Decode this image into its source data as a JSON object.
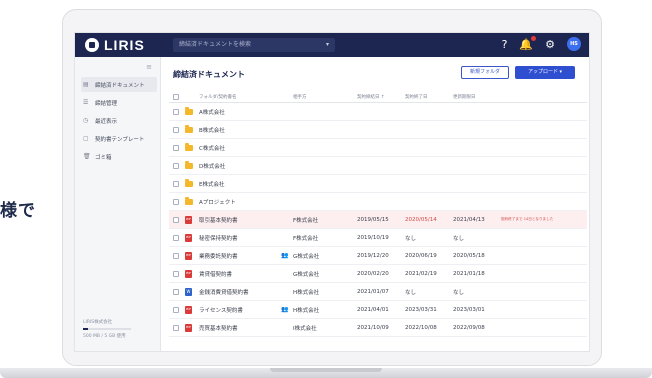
{
  "side_caption": "様で",
  "topbar": {
    "logo_text": "LIRIS",
    "search_placeholder": "締結済ドキュメントを検索",
    "search_caret": "▾",
    "help_icon": "?",
    "bell_icon": "🔔",
    "gear_icon": "⚙",
    "avatar_initials": "HS"
  },
  "sidebar": {
    "collapse_icon": "≡",
    "items": [
      {
        "icon": "▤",
        "label": "締結済ドキュメント",
        "active": true
      },
      {
        "icon": "☰",
        "label": "締結管理",
        "active": false
      },
      {
        "icon": "◷",
        "label": "最近表示",
        "active": false
      },
      {
        "icon": "▢",
        "label": "契約書テンプレート",
        "active": false
      },
      {
        "icon": "🗑",
        "label": "ゴミ箱",
        "active": false
      }
    ],
    "usage": {
      "company": "LIRIS株式会社",
      "progress": 0.1,
      "text": "500 MB / 5 GB 使用"
    }
  },
  "main": {
    "title": "締結済ドキュメント",
    "new_folder_label": "新規フォルダ",
    "upload_label": "アップロード ▾",
    "columns": {
      "name": "フォルダ/契約書名",
      "party": "相手方",
      "signed": "契約締結日 ↑",
      "end": "契約終了日",
      "renew": "更新期限日"
    },
    "rows": [
      {
        "type": "folder",
        "name": "A株式会社",
        "shared": "",
        "party": "",
        "signed": "",
        "end": "",
        "renew": "",
        "note": "",
        "highlight": false
      },
      {
        "type": "folder",
        "name": "B株式会社",
        "shared": "",
        "party": "",
        "signed": "",
        "end": "",
        "renew": "",
        "note": "",
        "highlight": false
      },
      {
        "type": "folder",
        "name": "C株式会社",
        "shared": "",
        "party": "",
        "signed": "",
        "end": "",
        "renew": "",
        "note": "",
        "highlight": false
      },
      {
        "type": "folder",
        "name": "D株式会社",
        "shared": "",
        "party": "",
        "signed": "",
        "end": "",
        "renew": "",
        "note": "",
        "highlight": false
      },
      {
        "type": "folder",
        "name": "E株式会社",
        "shared": "",
        "party": "",
        "signed": "",
        "end": "",
        "renew": "",
        "note": "",
        "highlight": false
      },
      {
        "type": "folder",
        "name": "Aプロジェクト",
        "shared": "",
        "party": "",
        "signed": "",
        "end": "",
        "renew": "",
        "note": "",
        "highlight": false
      },
      {
        "type": "pdf",
        "name": "取引基本契約書",
        "shared": "",
        "party": "F株式会社",
        "signed": "2019/05/15",
        "end": "2020/05/14",
        "renew": "2021/04/13",
        "note": "契約終了まで 14日となりました",
        "highlight": true
      },
      {
        "type": "pdf",
        "name": "秘密保持契約書",
        "shared": "",
        "party": "F株式会社",
        "signed": "2019/10/19",
        "end": "なし",
        "renew": "なし",
        "note": "",
        "highlight": false
      },
      {
        "type": "pdf",
        "name": "業務委託契約書",
        "shared": "👥",
        "party": "G株式会社",
        "signed": "2019/12/20",
        "end": "2020/06/19",
        "renew": "2020/05/18",
        "note": "",
        "highlight": false
      },
      {
        "type": "pdf",
        "name": "賃貸借契約書",
        "shared": "",
        "party": "G株式会社",
        "signed": "2020/02/20",
        "end": "2021/02/19",
        "renew": "2021/01/18",
        "note": "",
        "highlight": false
      },
      {
        "type": "word",
        "name": "金銭消費貸借契約書",
        "shared": "",
        "party": "H株式会社",
        "signed": "2021/01/07",
        "end": "なし",
        "renew": "なし",
        "note": "",
        "highlight": false
      },
      {
        "type": "pdf",
        "name": "ライセンス契約書",
        "shared": "👥",
        "party": "H株式会社",
        "signed": "2021/04/01",
        "end": "2023/03/31",
        "renew": "2023/03/01",
        "note": "",
        "highlight": false
      },
      {
        "type": "pdf",
        "name": "売買基本契約書",
        "shared": "",
        "party": "I株式会社",
        "signed": "2021/10/09",
        "end": "2022/10/08",
        "renew": "2022/09/08",
        "note": "",
        "highlight": false
      }
    ]
  },
  "colors": {
    "topbar": "#1c2650",
    "primary": "#2f4fd1",
    "alert": "#d24a4a",
    "folder": "#f5b82a"
  }
}
